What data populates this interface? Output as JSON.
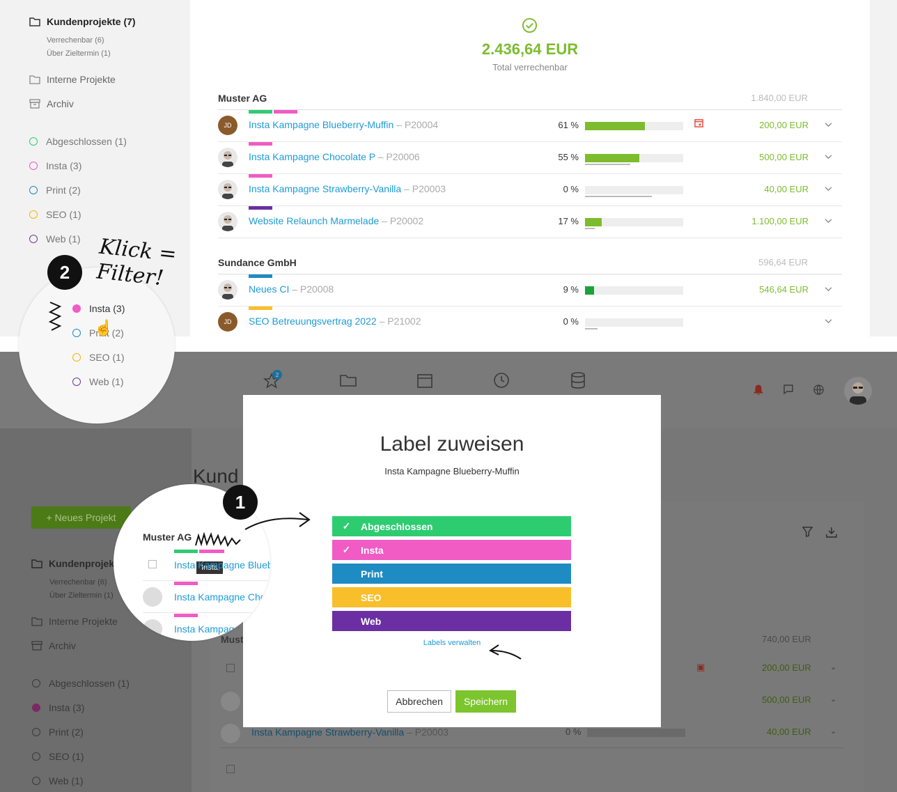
{
  "sidebar": {
    "customer_projects": "Kundenprojekte (7)",
    "billable": "Verrechenbar (6)",
    "overdue": "Über Zieltermin (1)",
    "internal": "Interne Projekte",
    "archive": "Archiv",
    "labels": [
      {
        "label": "Abgeschlossen (1)",
        "color": "#2ecc71"
      },
      {
        "label": "Insta (3)",
        "color": "#f05bc4"
      },
      {
        "label": "Print (2)",
        "color": "#1e8bc3"
      },
      {
        "label": "SEO (1)",
        "color": "#f5b50a"
      },
      {
        "label": "Web (1)",
        "color": "#6b3aa0"
      }
    ]
  },
  "summary": {
    "amount": "2.436,64 EUR",
    "label": "Total verrechenbar"
  },
  "groups": [
    {
      "name": "Muster AG",
      "amount": "1.840,00 EUR"
    },
    {
      "name": "Sundance GmbH",
      "amount": "596,64 EUR"
    }
  ],
  "projects": [
    {
      "title": "Insta Kampagne Blueberry-Muffin",
      "code": "– P20004",
      "pct": "61 %",
      "progress": 0.61,
      "amount": "200,00 EUR",
      "avatar": "JD"
    },
    {
      "title": "Insta Kampagne Chocolate P",
      "code": "– P20006",
      "pct": "55 %",
      "progress": 0.55,
      "amount": "500,00 EUR",
      "avatar": ""
    },
    {
      "title": "Insta Kampagne Strawberry-Vanilla",
      "code": "– P20003",
      "pct": "0 %",
      "progress": 0,
      "amount": "40,00 EUR",
      "avatar": ""
    },
    {
      "title": "Website Relaunch Marmelade",
      "code": "– P20002",
      "pct": "17 %",
      "progress": 0.17,
      "amount": "1.100,00 EUR",
      "avatar": ""
    },
    {
      "title": "Neues CI",
      "code": "– P20008",
      "pct": "9 %",
      "progress": 0.09,
      "amount": "546,64 EUR",
      "avatar": ""
    },
    {
      "title": "SEO Betreuungsvertrag 2022",
      "code": "– P21002",
      "pct": "0 %",
      "progress": 0,
      "amount": "",
      "avatar": "JD"
    }
  ],
  "annotation": {
    "step1": "1",
    "step2": "2",
    "hand_text": "Klick = Filter!"
  },
  "zoom_filter": [
    {
      "label": "Insta (3)"
    },
    {
      "label": "Print (2)"
    },
    {
      "label": "SEO (1)"
    },
    {
      "label": "Web (1)"
    }
  ],
  "zoom_label": {
    "group": "Muster AG",
    "tooltip": "Insta",
    "rows": [
      "Insta Kampagne Blueb",
      "Insta Kampagne Cho",
      "Insta Kampag"
    ]
  },
  "app": {
    "notification_count": "2",
    "page_title_partial": "Kund",
    "new_project": "+ Neues Projekt",
    "bg_group": "Must",
    "bg_group_amount": "740,00 EUR",
    "bg_rows": [
      {
        "title": "Insta Kampagne Strawberry-Vanilla",
        "code": "– P20003",
        "pct": "0 %",
        "amount": "40,00 EUR"
      }
    ],
    "bg_amounts": [
      "200,00 EUR",
      "500,00 EUR"
    ]
  },
  "modal": {
    "title": "Label zuweisen",
    "subtitle": "Insta Kampagne Blueberry-Muffin",
    "labels": [
      {
        "name": "Abgeschlossen",
        "color": "#2ecc71",
        "checked": true
      },
      {
        "name": "Insta",
        "color": "#f05bc4",
        "checked": true
      },
      {
        "name": "Print",
        "color": "#1e8bc3",
        "checked": false
      },
      {
        "name": "SEO",
        "color": "#f9bf2b",
        "checked": false
      },
      {
        "name": "Web",
        "color": "#6b2fa3",
        "checked": false
      }
    ],
    "manage_link": "Labels verwalten",
    "cancel": "Abbrechen",
    "save": "Speichern"
  }
}
